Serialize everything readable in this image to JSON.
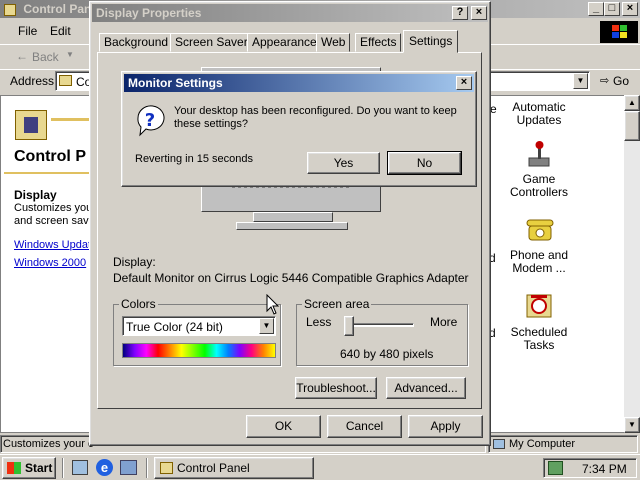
{
  "bg_window": {
    "title": "Control Panel",
    "menu": [
      "File",
      "Edit"
    ],
    "back_label": "Back",
    "address_label": "Address",
    "address_value": "Co",
    "go_label": "Go",
    "heading": "Control P",
    "section_title": "Display",
    "section_desc_1": "Customizes you",
    "section_desc_2": "and screen save",
    "link_1": "Windows Updat",
    "link_2": "Windows 2000",
    "items": [
      {
        "label": "Automatic Updates",
        "icon": "globe-icon"
      },
      {
        "label": "Game Controllers",
        "icon": "joystick-icon"
      },
      {
        "label": "Phone and Modem ...",
        "icon": "phone-icon"
      },
      {
        "label": "Scheduled Tasks",
        "icon": "calendar-icon"
      }
    ],
    "status_left": "Customizes your c",
    "status_right": "My Computer",
    "partial_e": "e",
    "partial_d1": "d",
    "partial_d2": "d"
  },
  "display_props": {
    "title": "Display Properties",
    "tabs": [
      "Background",
      "Screen Saver",
      "Appearance",
      "Web",
      "Effects",
      "Settings"
    ],
    "active_tab": "Settings",
    "display_label": "Display:",
    "display_value": "Default Monitor on Cirrus Logic 5446 Compatible Graphics Adapter",
    "colors_label": "Colors",
    "colors_value": "True Color (24 bit)",
    "screen_area_label": "Screen area",
    "less_label": "Less",
    "more_label": "More",
    "resolution": "640 by 480 pixels",
    "slider_position": 0,
    "troubleshoot_label": "Troubleshoot...",
    "advanced_label": "Advanced...",
    "ok_label": "OK",
    "cancel_label": "Cancel",
    "apply_label": "Apply"
  },
  "dialog": {
    "title": "Monitor Settings",
    "message": "Your desktop has been reconfigured.  Do you want to keep these settings?",
    "countdown": "Reverting in 15 seconds",
    "yes_label": "Yes",
    "no_label": "No"
  },
  "taskbar": {
    "start_label": "Start",
    "task_label": "Control Panel",
    "clock": "7:34 PM"
  },
  "colors": {
    "title_active": "#0a246a",
    "title_active_end": "#a6caf0",
    "title_inactive": "#808080",
    "title_inactive_end": "#c0c0c0"
  }
}
